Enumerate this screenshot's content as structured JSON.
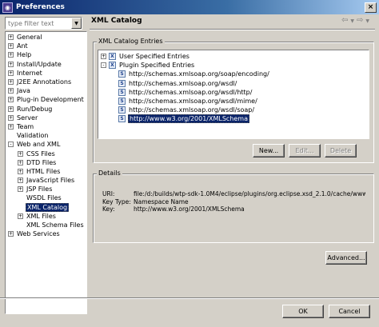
{
  "window": {
    "title": "Preferences"
  },
  "filter": {
    "placeholder": "type filter text"
  },
  "nav": [
    {
      "label": "General",
      "toggle": "+",
      "indent": 0
    },
    {
      "label": "Ant",
      "toggle": "+",
      "indent": 0
    },
    {
      "label": "Help",
      "toggle": "+",
      "indent": 0
    },
    {
      "label": "Install/Update",
      "toggle": "+",
      "indent": 0
    },
    {
      "label": "Internet",
      "toggle": "+",
      "indent": 0
    },
    {
      "label": "J2EE Annotations",
      "toggle": "+",
      "indent": 0
    },
    {
      "label": "Java",
      "toggle": "+",
      "indent": 0
    },
    {
      "label": "Plug-in Development",
      "toggle": "+",
      "indent": 0
    },
    {
      "label": "Run/Debug",
      "toggle": "+",
      "indent": 0
    },
    {
      "label": "Server",
      "toggle": "+",
      "indent": 0
    },
    {
      "label": "Team",
      "toggle": "+",
      "indent": 0
    },
    {
      "label": "Validation",
      "toggle": "",
      "indent": 0
    },
    {
      "label": "Web and XML",
      "toggle": "-",
      "indent": 0
    },
    {
      "label": "CSS Files",
      "toggle": "+",
      "indent": 1
    },
    {
      "label": "DTD Files",
      "toggle": "+",
      "indent": 1
    },
    {
      "label": "HTML Files",
      "toggle": "+",
      "indent": 1
    },
    {
      "label": "JavaScript Files",
      "toggle": "+",
      "indent": 1
    },
    {
      "label": "JSP Files",
      "toggle": "+",
      "indent": 1
    },
    {
      "label": "WSDL Files",
      "toggle": "",
      "indent": 1
    },
    {
      "label": "XML Catalog",
      "toggle": "",
      "indent": 1,
      "selected": true
    },
    {
      "label": "XML Files",
      "toggle": "+",
      "indent": 1
    },
    {
      "label": "XML Schema Files",
      "toggle": "",
      "indent": 1
    },
    {
      "label": "Web Services",
      "toggle": "+",
      "indent": 0
    }
  ],
  "page": {
    "title": "XML Catalog"
  },
  "entries_group": {
    "label": "XML Catalog Entries"
  },
  "entries": [
    {
      "label": "User Specified Entries",
      "toggle": "+",
      "indent": 0,
      "icon": "X"
    },
    {
      "label": "Plugin Specified Entries",
      "toggle": "-",
      "indent": 0,
      "icon": "X"
    },
    {
      "label": "http://schemas.xmlsoap.org/soap/encoding/",
      "toggle": "",
      "indent": 1,
      "icon": "S"
    },
    {
      "label": "http://schemas.xmlsoap.org/wsdl/",
      "toggle": "",
      "indent": 1,
      "icon": "S"
    },
    {
      "label": "http://schemas.xmlsoap.org/wsdl/http/",
      "toggle": "",
      "indent": 1,
      "icon": "S"
    },
    {
      "label": "http://schemas.xmlsoap.org/wsdl/mime/",
      "toggle": "",
      "indent": 1,
      "icon": "S"
    },
    {
      "label": "http://schemas.xmlsoap.org/wsdl/soap/",
      "toggle": "",
      "indent": 1,
      "icon": "S"
    },
    {
      "label": "http://www.w3.org/2001/XMLSchema",
      "toggle": "",
      "indent": 1,
      "icon": "S",
      "selected": true
    }
  ],
  "entry_buttons": {
    "new": "New...",
    "edit": "Edit...",
    "delete": "Delete"
  },
  "details_group": {
    "label": "Details"
  },
  "details": {
    "uri_key": "URI:",
    "uri_value": "file:/d:/builds/wtp-sdk-1.0M4/eclipse/plugins/org.eclipse.xsd_2.1.0/cache/www.w3.org",
    "type_key": "Key Type:",
    "type_value": "Namespace Name",
    "key_key": "Key:",
    "key_value": "http://www.w3.org/2001/XMLSchema"
  },
  "advanced_button": "Advanced...",
  "dialog_buttons": {
    "ok": "OK",
    "cancel": "Cancel"
  }
}
